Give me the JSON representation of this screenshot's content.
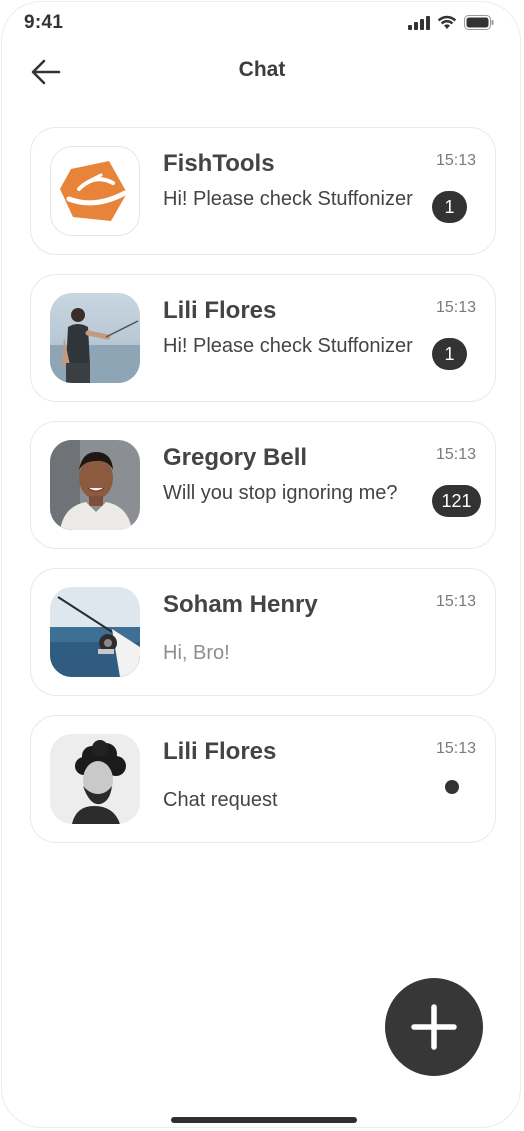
{
  "status_bar": {
    "time": "9:41",
    "icons": [
      "signal-icon",
      "wifi-icon",
      "battery-icon"
    ]
  },
  "header": {
    "title": "Chat",
    "back_icon": "arrow-left-icon"
  },
  "colors": {
    "accent_orange": "#e8843a",
    "badge_bg": "#333333",
    "fab_bg": "#373737",
    "card_border": "#e9e9e9"
  },
  "chats": [
    {
      "name": "FishTools",
      "message": "Hi! Please check Stuffonizer",
      "time": "15:13",
      "badge": "1",
      "avatar": "fishtools-logo"
    },
    {
      "name": "Lili Flores",
      "message": "Hi! Please check Stuffonizer",
      "time": "15:13",
      "badge": "1",
      "avatar": "person-fishing-photo"
    },
    {
      "name": "Gregory Bell",
      "message": "Will you stop ignoring me?",
      "time": "15:13",
      "badge": "121",
      "avatar": "man-portrait-photo"
    },
    {
      "name": "Soham Henry",
      "message": "Hi, Bro!",
      "time": "15:13",
      "avatar": "fishing-rod-photo"
    },
    {
      "name": "Lili Flores",
      "message": "Chat request",
      "time": "15:13",
      "indicator": "unread-dot",
      "avatar": "curly-hair-man-photo"
    }
  ],
  "fab": {
    "icon": "plus-icon"
  }
}
